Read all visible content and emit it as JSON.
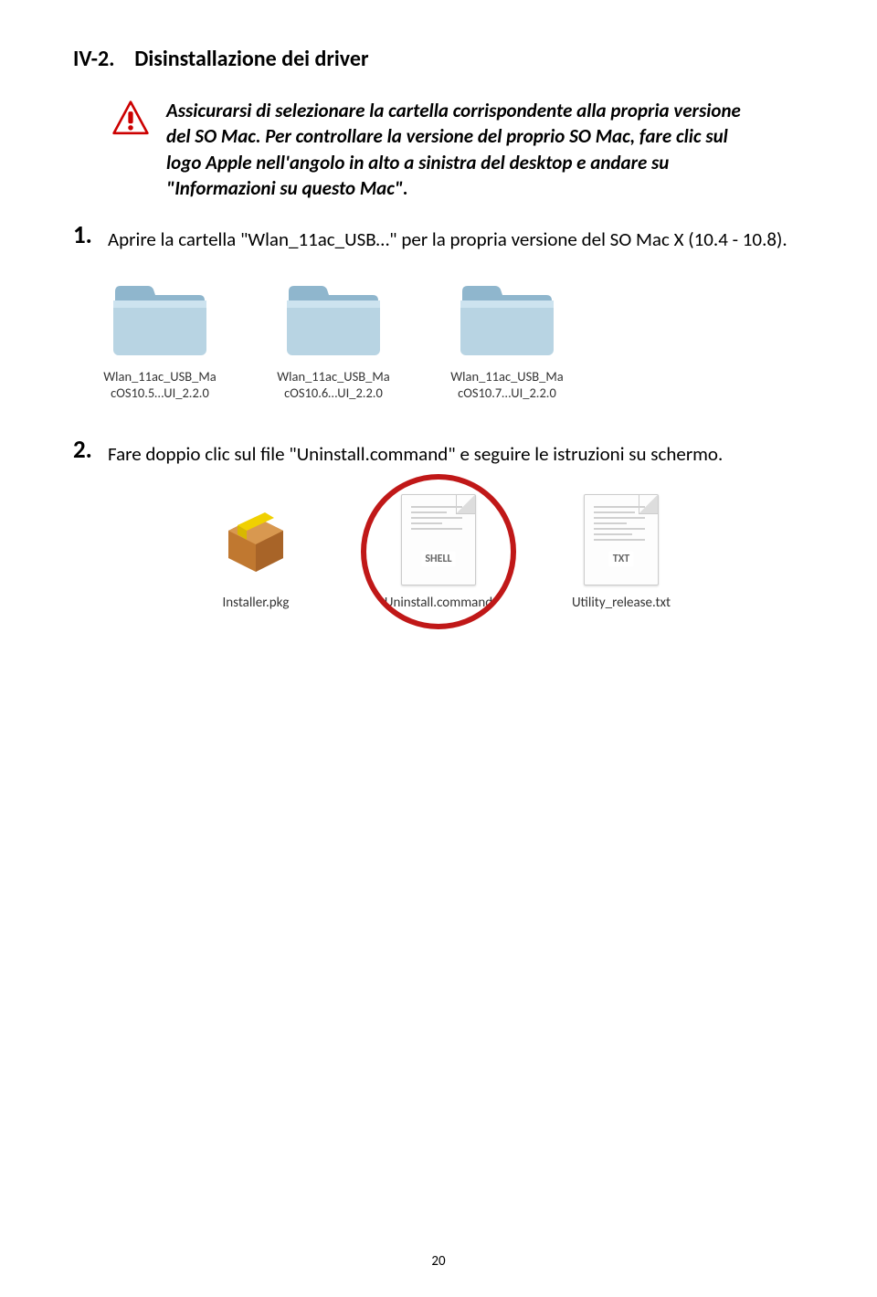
{
  "heading": {
    "section_number": "IV-2.",
    "section_title": "Disinstallazione dei driver"
  },
  "warning": {
    "text": "Assicurarsi di selezionare la cartella corrispondente alla propria versione del SO Mac. Per controllare la versione del proprio SO Mac, fare clic sul logo Apple nell'angolo in alto a sinistra del desktop e andare su \"Informazioni su questo Mac\"."
  },
  "step1": {
    "number": "1.",
    "text": "Aprire la cartella \"Wlan_11ac_USB…\" per la propria versione del SO Mac X (10.4 - 10.8)."
  },
  "step2": {
    "number": "2.",
    "text": "Fare doppio clic sul file \"Uninstall.command\" e seguire le istruzioni su schermo."
  },
  "folders": [
    {
      "line1": "Wlan_11ac_USB_Ma",
      "line2": "cOS10.5…UI_2.2.0"
    },
    {
      "line1": "Wlan_11ac_USB_Ma",
      "line2": "cOS10.6…UI_2.2.0"
    },
    {
      "line1": "Wlan_11ac_USB_Ma",
      "line2": "cOS10.7…UI_2.2.0"
    }
  ],
  "files": [
    {
      "label": "Installer.pkg",
      "type": "pkg"
    },
    {
      "label": "Uninstall.command",
      "type": "shell",
      "highlighted": true
    },
    {
      "label": "Utility_release.txt",
      "type": "txt"
    }
  ],
  "doc_badges": {
    "shell": "SHELL",
    "txt": "TXT"
  },
  "page_number": "20"
}
